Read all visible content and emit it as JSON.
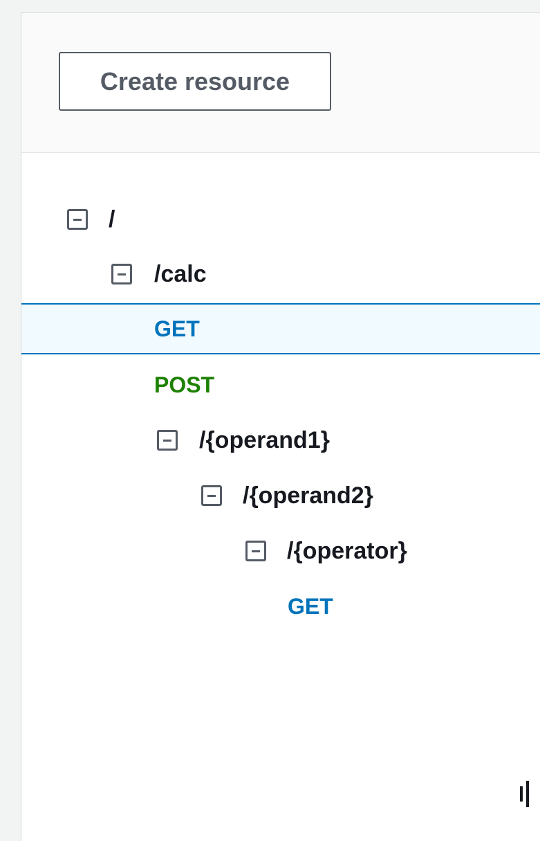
{
  "toolbar": {
    "create_resource_label": "Create resource"
  },
  "tree": {
    "root": {
      "label": "/"
    },
    "calc": {
      "label": "/calc"
    },
    "calc_get": {
      "label": "GET"
    },
    "calc_post": {
      "label": "POST"
    },
    "operand1": {
      "label": "/{operand1}"
    },
    "operand2": {
      "label": "/{operand2}"
    },
    "operator": {
      "label": "/{operator}"
    },
    "operator_get": {
      "label": "GET"
    }
  },
  "selected_node": "calc_get",
  "icons": {
    "collapse": "minus-square-icon",
    "resize": "resize-handle-icon"
  },
  "colors": {
    "get_method": "#0073bb",
    "post_method": "#1d8102",
    "selected_border": "#0073bb",
    "selected_background": "#f1faff",
    "text": "#16191f",
    "icon": "#545b64"
  }
}
